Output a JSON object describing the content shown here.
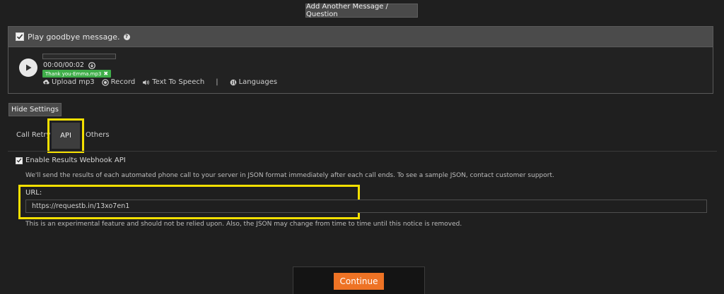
{
  "top_button": {
    "label": "Add Another Message / Question"
  },
  "goodbye": {
    "checkbox_label": "Play goodbye message.",
    "time": "00:00/00:02",
    "file_badge": "Thank you-Emma.mp3",
    "tools": {
      "upload": "Upload mp3",
      "record": "Record",
      "tts": "Text To Speech",
      "separator": "|",
      "languages": "Languages"
    }
  },
  "settings": {
    "hide_button": "Hide Settings",
    "tabs": [
      {
        "label": "Call Retry"
      },
      {
        "label": "API"
      },
      {
        "label": "Others"
      }
    ]
  },
  "api": {
    "enable_label": "Enable Results Webhook API",
    "description": "We'll send the results of each automated phone call to your server in JSON format immediately after each call ends. To see a sample JSON, contact customer support.",
    "url_label": "URL:",
    "url_value": "https://requestb.in/13xo7en1",
    "notice": "This is an experimental feature and should not be relied upon. Also, the JSON may change from time to time until this notice is removed."
  },
  "footer": {
    "continue_label": "Continue"
  },
  "colors": {
    "accent": "#ee7325",
    "highlight": "#f5e000",
    "badge": "#3fae49"
  }
}
